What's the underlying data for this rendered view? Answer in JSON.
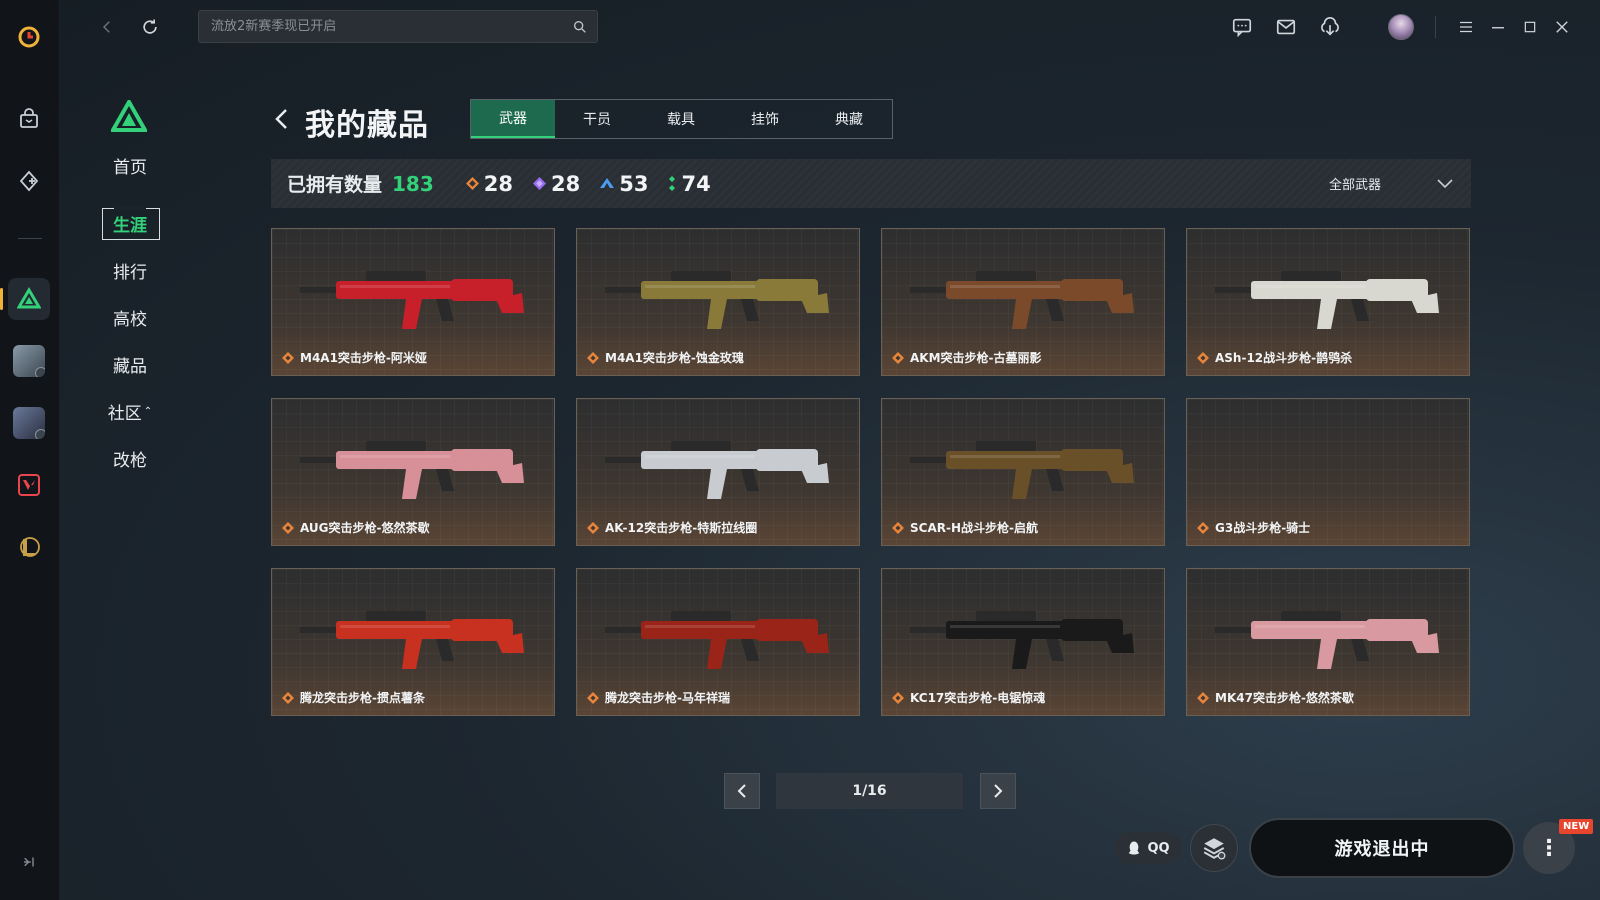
{
  "colors": {
    "accent": "#33d17a",
    "brand": "#f0b33a",
    "rarity_orange": "#e8853a",
    "rarity_purple": "#9a6cf0",
    "rarity_blue": "#4a9cf0",
    "rarity_green": "#33d17a"
  },
  "rail": {
    "items": [
      {
        "icon": "launcher-logo-icon"
      },
      {
        "icon": "shop-bag-icon"
      },
      {
        "icon": "game-add-icon"
      },
      {
        "icon": "delta-force-icon"
      },
      {
        "icon": "game-thumb-1-icon"
      },
      {
        "icon": "game-thumb-2-icon"
      },
      {
        "icon": "valorant-icon"
      },
      {
        "icon": "league-icon"
      }
    ]
  },
  "topbar": {
    "search_placeholder": "流放2新赛季现已开启"
  },
  "subnav": {
    "items": [
      {
        "label": "首页"
      },
      {
        "label": "生涯"
      },
      {
        "label": "排行"
      },
      {
        "label": "高校"
      },
      {
        "label": "藏品"
      },
      {
        "label": "社区"
      },
      {
        "label": "改枪"
      }
    ],
    "active": "生涯"
  },
  "page": {
    "title": "我的藏品",
    "tabs": [
      {
        "label": "武器"
      },
      {
        "label": "干员"
      },
      {
        "label": "载具"
      },
      {
        "label": "挂饰"
      },
      {
        "label": "典藏"
      }
    ],
    "active_tab": "武器"
  },
  "stats": {
    "owned_label": "已拥有数量",
    "owned_value": "183",
    "rarities": [
      {
        "icon": "orange-rarity-icon",
        "color": "#e8853a",
        "value": "28"
      },
      {
        "icon": "purple-rarity-icon",
        "color": "#9a6cf0",
        "value": "28"
      },
      {
        "icon": "blue-rarity-icon",
        "color": "#4a9cf0",
        "value": "53"
      },
      {
        "icon": "green-rarity-icon",
        "color": "#33d17a",
        "value": "74"
      }
    ],
    "filter_label": "全部武器"
  },
  "items": [
    {
      "name": "M4A1突击步枪-阿米娅",
      "color": "#c8202a"
    },
    {
      "name": "M4A1突击步枪-蚀金玫瑰",
      "color": "#8a7a3a"
    },
    {
      "name": "AKM突击步枪-古墓丽影",
      "color": "#7a4a2a"
    },
    {
      "name": "ASh-12战斗步枪-鹊鸮杀",
      "color": "#d8d8d0"
    },
    {
      "name": "AUG突击步枪-悠然茶歇",
      "color": "#d89098"
    },
    {
      "name": "AK-12突击步枪-特斯拉线圈",
      "color": "#c8ccd0"
    },
    {
      "name": "SCAR-H战斗步枪-启航",
      "color": "#6a5028"
    },
    {
      "name": "G3战斗步枪-骑士",
      "color": ""
    },
    {
      "name": "腾龙突击步枪-掼点薯条",
      "color": "#c83020"
    },
    {
      "name": "腾龙突击步枪-马年祥瑞",
      "color": "#9a2418"
    },
    {
      "name": "KC17突击步枪-电锯惊魂",
      "color": "#1a1a1a"
    },
    {
      "name": "MK47突击步枪-悠然茶歇",
      "color": "#d89aa0"
    }
  ],
  "pagination": {
    "current": "1/16"
  },
  "bottom": {
    "qq_label": "QQ",
    "launch_label": "游戏退出中",
    "new_badge": "NEW"
  }
}
